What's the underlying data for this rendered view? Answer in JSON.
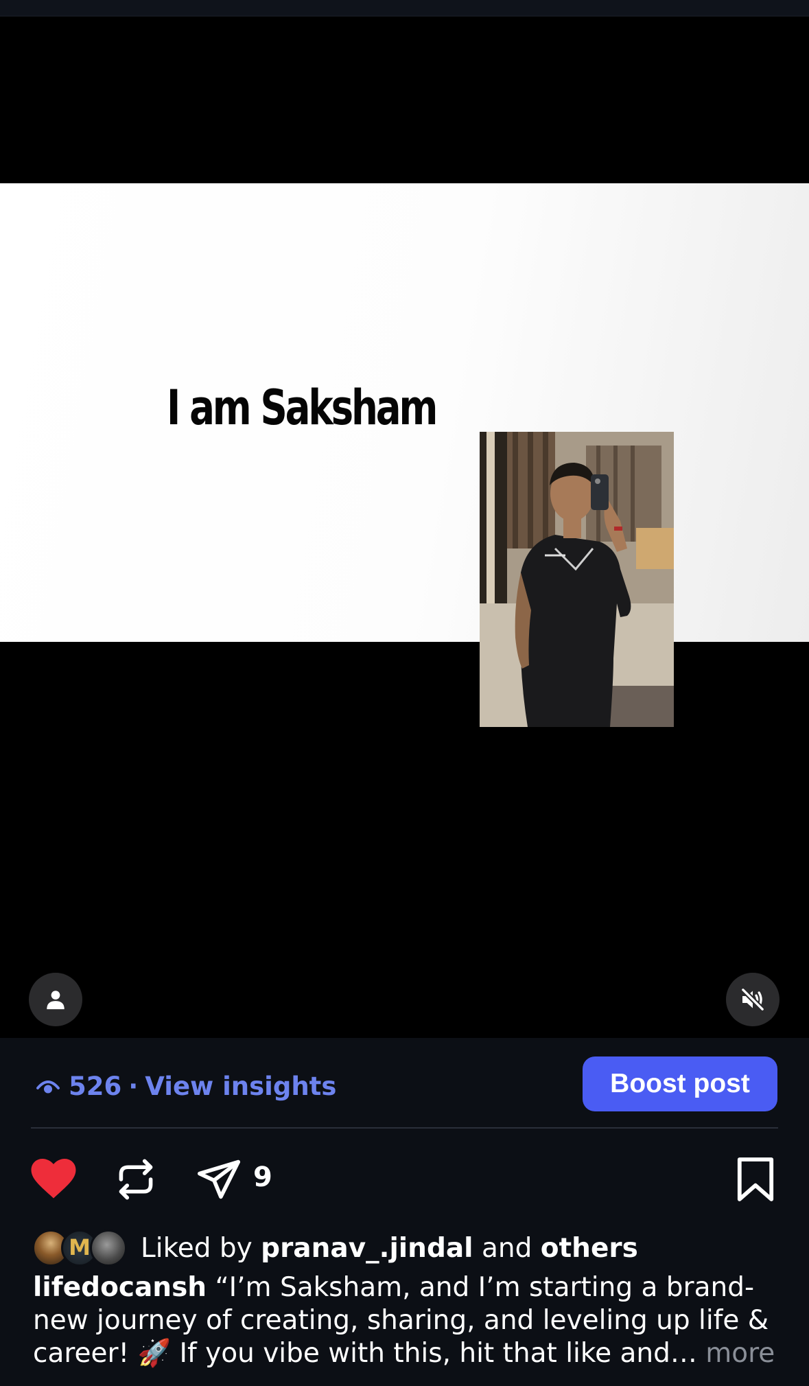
{
  "slide": {
    "title": "I am Saksham"
  },
  "stats": {
    "views": "526",
    "separator": "·",
    "insights_label": "View insights",
    "boost_label": "Boost post"
  },
  "actions": {
    "share_count": "9"
  },
  "likes": {
    "prefix": "Liked by",
    "user": "pranav_.jindal",
    "conj": "and",
    "others": "others",
    "avatar2_letter": "M"
  },
  "caption": {
    "username": "lifedocansh",
    "text": "“I’m Saksham, and I’m starting a brand-new journey of creating, sharing, and leveling up life & career! 🚀 If you vibe with this, hit that like and…",
    "more": "more"
  },
  "colors": {
    "accent": "#4a5cf3",
    "link": "#6d83ee",
    "like": "#ee2d3a",
    "background": "#0c0f15"
  },
  "icons": {
    "user": "person-icon",
    "mute": "speaker-muted-icon",
    "like": "heart-filled-icon",
    "repost": "repost-icon",
    "share": "paper-plane-icon",
    "save": "bookmark-icon",
    "views": "eye-icon"
  }
}
